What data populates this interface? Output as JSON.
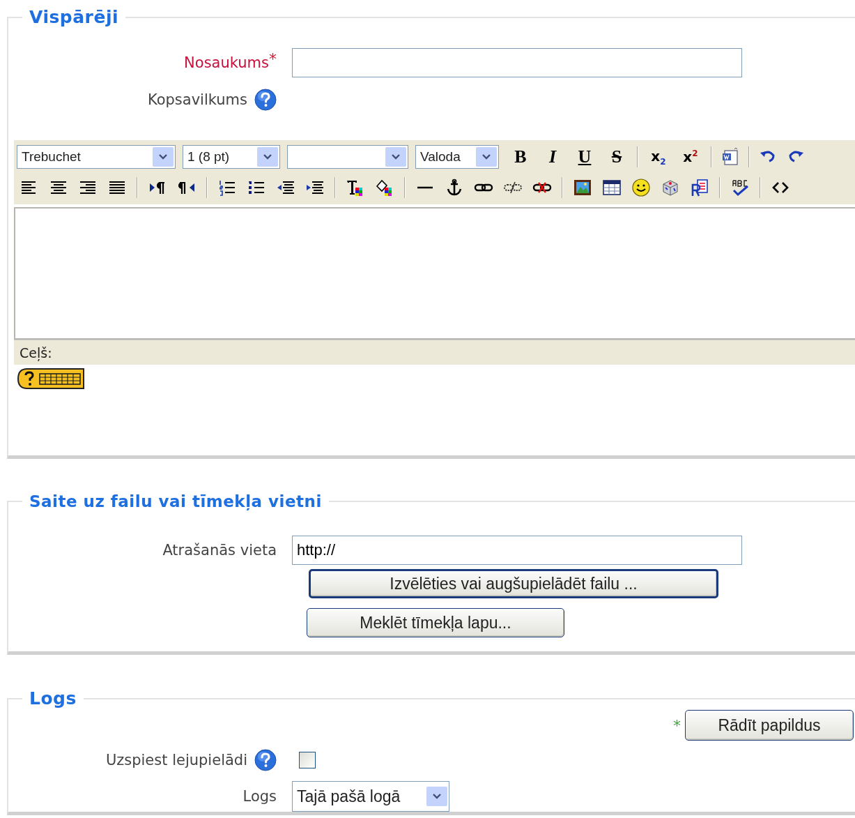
{
  "sections": [
    {
      "title": "Vispārēji",
      "kind": "general"
    },
    {
      "title": "Saite uz failu vai tīmekļa vietni",
      "kind": "link"
    },
    {
      "title": "Logs",
      "kind": "window"
    }
  ],
  "general": {
    "name_label": "Nosaukums",
    "name_required": true,
    "required_mark": "*",
    "summary_label": "Kopsavilkums",
    "editor": {
      "selects": [
        {
          "kind": "text",
          "value": "Trebuchet"
        },
        {
          "kind": "text",
          "value": "1 (8 pt)"
        },
        {
          "kind": "blank"
        },
        {
          "kind": "text",
          "value": "Valoda"
        }
      ],
      "format_buttons": [
        {
          "kind": "bold",
          "label": "B"
        },
        {
          "kind": "italic",
          "label": "I"
        },
        {
          "kind": "underline",
          "label": "U"
        },
        {
          "kind": "strike",
          "label": "S"
        }
      ],
      "script_buttons": [
        "x$_{2}$",
        "x$^{2}$"
      ],
      "path_label": "Ceļš:"
    }
  },
  "link": {
    "location_label": "Atrašanās vieta",
    "location_value": "http://",
    "choose_button": "Izvēlēties vai augšupielādēt failu ...",
    "search_button": "Meklēt tīmekļa lapu..."
  },
  "window": {
    "advanced_mark": "*",
    "advanced_button": "Rādīt papildus",
    "force_label": "Uzspiest lejupielādi",
    "force_checked": false,
    "window_label": "Logs",
    "window_value": "Tajā pašā logā"
  }
}
